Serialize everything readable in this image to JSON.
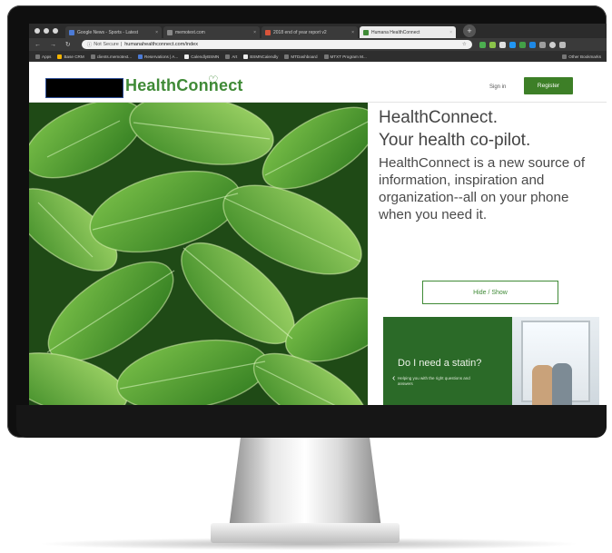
{
  "browser": {
    "tabs": [
      {
        "label": "Google News - Sports - Latest",
        "active": false
      },
      {
        "label": "memotext.com",
        "active": false
      },
      {
        "label": "2018 end of year report v2",
        "active": false
      },
      {
        "label": "Humana HealthConnect",
        "active": true
      }
    ],
    "address": {
      "security": "Not Secure",
      "url": "humanahealthconnect.com/index"
    },
    "bookmarks": [
      "Apps",
      "Base CRM",
      "clients.memotext...",
      "Reservations | A...",
      "CalendlyBSMN",
      "Art",
      "BSMNCalendly",
      "MTDashboard",
      "MTXT Program M..."
    ],
    "other_bookmarks": "Other Bookmarks"
  },
  "site": {
    "brand": "HealthConnect",
    "brand_mark": "♡",
    "sign_in": "Sign in",
    "register": "Register"
  },
  "hero": {
    "title": "HealthConnect.",
    "subtitle": "Your health co-pilot.",
    "description": "HealthConnect is a new source of information, inspiration and organization--all on your phone when you need it.",
    "toggle_button": "Hide / Show"
  },
  "card": {
    "title": "Do I need a statin?",
    "subtitle": "Helping you with the right questions and answers",
    "arrow": "‹"
  },
  "colors": {
    "brand_green": "#3f8a36",
    "button_green": "#3d7f27",
    "card_green": "#2b6a28"
  }
}
